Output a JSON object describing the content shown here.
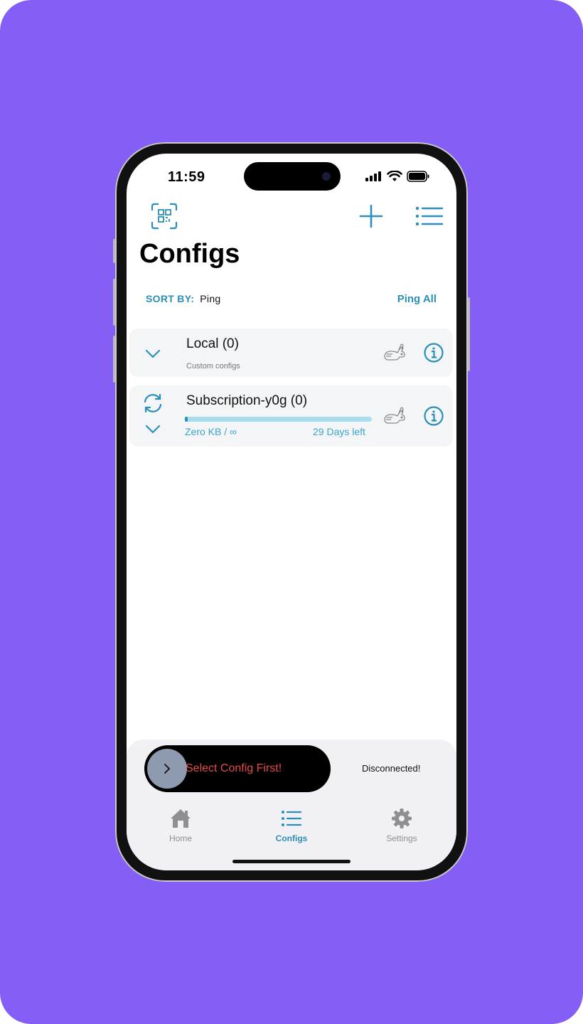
{
  "status": {
    "time": "11:59"
  },
  "header": {
    "title": "Configs"
  },
  "sort": {
    "label": "SORT BY:",
    "value": "Ping",
    "ping_all": "Ping All"
  },
  "groups": [
    {
      "name": "Local (0)",
      "subtitle": "Custom configs"
    },
    {
      "name": "Subscription-y0g (0)",
      "usage": "Zero KB / ∞",
      "days_left": "29 Days left",
      "usage_fraction": 0.01
    }
  ],
  "connect": {
    "slider_label": "Select Config First!",
    "status": "Disconnected!"
  },
  "tabs": [
    {
      "label": "Home",
      "icon": "home-icon",
      "active": false
    },
    {
      "label": "Configs",
      "icon": "list-icon",
      "active": true
    },
    {
      "label": "Settings",
      "icon": "gear-icon",
      "active": false
    }
  ],
  "colors": {
    "accent": "#2b8fb8",
    "background": "#845ef5",
    "error": "#e84a4a"
  }
}
